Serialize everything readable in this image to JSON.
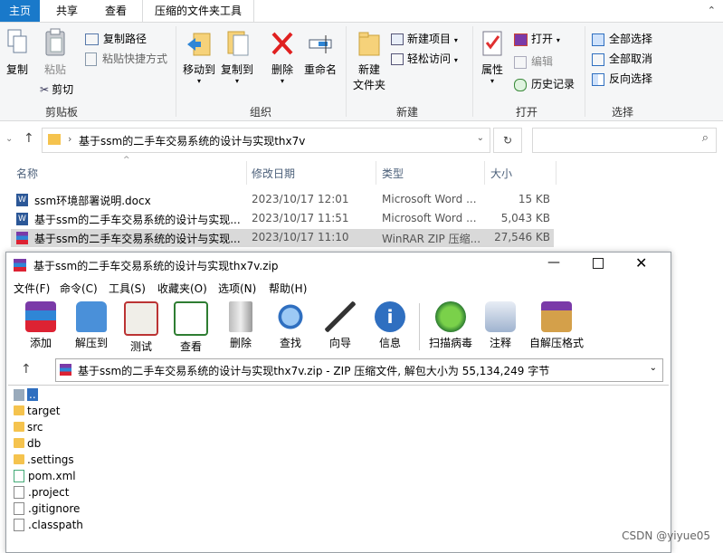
{
  "tabs": [
    "主页",
    "共享",
    "查看",
    "压缩的文件夹工具"
  ],
  "ribbon": {
    "clipboard": {
      "copy": "复制",
      "paste": "粘贴",
      "copy_path": "复制路径",
      "paste_shortcut": "粘贴快捷方式",
      "cut": "剪切",
      "group": "剪贴板"
    },
    "organize": {
      "move_to": "移动到",
      "copy_to": "复制到",
      "delete": "删除",
      "rename": "重命名",
      "group": "组织"
    },
    "new": {
      "new_folder_l1": "新建",
      "new_folder_l2": "文件夹",
      "new_item": "新建项目",
      "easy_access": "轻松访问",
      "group": "新建"
    },
    "open": {
      "properties": "属性",
      "open": "打开",
      "edit": "编辑",
      "history": "历史记录",
      "group": "打开"
    },
    "select": {
      "select_all": "全部选择",
      "select_none": "全部取消",
      "invert": "反向选择",
      "group": "选择"
    }
  },
  "address": {
    "path": "基于ssm的二手车交易系统的设计与实现thx7v",
    "search_placeholder": ""
  },
  "columns": {
    "name": "名称",
    "date": "修改日期",
    "type": "类型",
    "size": "大小"
  },
  "files": [
    {
      "name": "ssm环境部署说明.docx",
      "date": "2023/10/17 12:01",
      "type": "Microsoft Word ...",
      "size": "15 KB"
    },
    {
      "name": "基于ssm的二手车交易系统的设计与实现...",
      "date": "2023/10/17 11:51",
      "type": "Microsoft Word ...",
      "size": "5,043 KB"
    },
    {
      "name": "基于ssm的二手车交易系统的设计与实现...",
      "date": "2023/10/17 11:10",
      "type": "WinRAR ZIP 压缩...",
      "size": "27,546 KB"
    }
  ],
  "rar": {
    "title": "基于ssm的二手车交易系统的设计与实现thx7v.zip",
    "menu": [
      "文件(F)",
      "命令(C)",
      "工具(S)",
      "收藏夹(O)",
      "选项(N)",
      "帮助(H)"
    ],
    "toolbar": [
      "添加",
      "解压到",
      "测试",
      "查看",
      "删除",
      "查找",
      "向导",
      "信息",
      "扫描病毒",
      "注释",
      "自解压格式"
    ],
    "path": "基于ssm的二手车交易系统的设计与实现thx7v.zip - ZIP 压缩文件, 解包大小为 55,134,249 字节",
    "items": [
      {
        "name": "..",
        "kind": "up"
      },
      {
        "name": "target",
        "kind": "folder"
      },
      {
        "name": "src",
        "kind": "folder"
      },
      {
        "name": "db",
        "kind": "folder"
      },
      {
        "name": ".settings",
        "kind": "folder"
      },
      {
        "name": "pom.xml",
        "kind": "xml"
      },
      {
        "name": ".project",
        "kind": "file"
      },
      {
        "name": ".gitignore",
        "kind": "file"
      },
      {
        "name": ".classpath",
        "kind": "file"
      }
    ]
  },
  "watermark": "CSDN @yiyue05"
}
